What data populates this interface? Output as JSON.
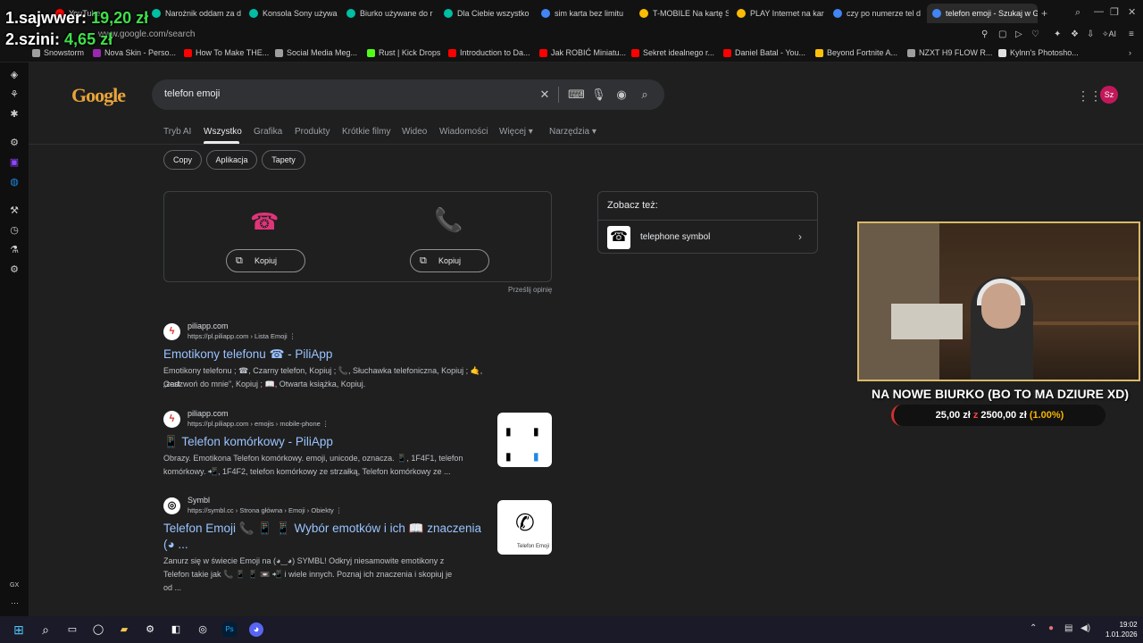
{
  "browser": {
    "tabs": [
      {
        "label": "YouTube",
        "color": "#ff0000"
      },
      {
        "label": "Narożnik oddam za d",
        "color": "#e91e63"
      },
      {
        "label": "Konsola Sony używa",
        "color": "#00bfa5"
      },
      {
        "label": "Biurko używane do r",
        "color": "#00bfa5"
      },
      {
        "label": "Dla Ciebie wszystko",
        "color": "#00bfa5"
      },
      {
        "label": "sim karta bez limitu",
        "color": "#4285f4"
      },
      {
        "label": "T-MOBILE Na kartę S",
        "color": "#fbbc04"
      },
      {
        "label": "PLAY Internet na kar",
        "color": "#fbbc04"
      },
      {
        "label": "czy po numerze tel d",
        "color": "#4285f4"
      },
      {
        "label": "telefon emoji - Szukaj w G",
        "color": "#4285f4"
      }
    ],
    "url": "www.google.com/search",
    "bookmarks": [
      {
        "label": "Snowstorm",
        "color": "#9e9e9e"
      },
      {
        "label": "Nova Skin - Perso...",
        "color": "#9c27b0"
      },
      {
        "label": "How To Make THE...",
        "color": "#ff0000"
      },
      {
        "label": "Social Media Meg...",
        "color": "#9e9e9e"
      },
      {
        "label": "Rust | Kick Drops",
        "color": "#53fc18"
      },
      {
        "label": "Introduction to Da...",
        "color": "#ff0000"
      },
      {
        "label": "Jak ROBIĆ Miniatu...",
        "color": "#ff0000"
      },
      {
        "label": "Sekret idealnego r...",
        "color": "#ff0000"
      },
      {
        "label": "Daniel Batal - You...",
        "color": "#ff0000"
      },
      {
        "label": "Beyond Fortnite A...",
        "color": "#ffc107"
      },
      {
        "label": "NZXT H9 FLOW R...",
        "color": "#9e9e9e"
      },
      {
        "label": "Kylnn's Photosho...",
        "color": "#e0e0e0"
      }
    ]
  },
  "google": {
    "logo": "Google",
    "query": "telefon emoji",
    "avatar": "Sz",
    "nav_tabs": [
      "Tryb AI",
      "Wszystko",
      "Grafika",
      "Produkty",
      "Krótkie filmy",
      "Wideo",
      "Wiadomości",
      "Więcej",
      "Narzędzia"
    ],
    "chips": [
      "Copy",
      "Aplikacja",
      "Tapety"
    ],
    "emoji_card": {
      "emojis": [
        "☎",
        "📞"
      ],
      "copy_label": "Kopiuj",
      "feedback": "Prześlij opinię"
    },
    "see_also": {
      "title": "Zobacz też:",
      "item": "telephone symbol"
    },
    "results": [
      {
        "site": "piliapp.com",
        "cite": "https://pl.piliapp.com › Lista Emoji",
        "title": "Emotikony telefonu ☎ - PiliApp",
        "snippet1": "Emotikony telefonu ; ☎, Czarny telefon, Kopiuj ; 📞, Słuchawka telefoniczna, Kopiuj ; 🤙, Gest",
        "snippet2": "„zadzwoń do mnie”, Kopiuj ; 📖, Otwarta książka, Kopiuj."
      },
      {
        "site": "piliapp.com",
        "cite": "https://pl.piliapp.com › emojis › mobile-phone",
        "title": "📱 Telefon komórkowy - PiliApp",
        "snippet1": "Obrazy. Emotikona Telefon komórkowy. emoji, unicode, oznacza. 📱, 1F4F1, telefon",
        "snippet2": "komórkowy. 📲, 1F4F2, telefon komórkowy ze strzałką, Telefon komórkowy ze ..."
      },
      {
        "site": "Symbl",
        "cite": "https://symbl.cc › Strona główna › Emoji › Obiekty",
        "title": "Telefon Emoji 📞 📱 📱 Wybór emotków i ich 📖 znaczenia",
        "title2": "(◕ ...",
        "snippet1": "Zanurz się w świecie Emoji na (◕‿◕) SYMBL! Odkryj niesamowite emotikony z",
        "snippet2": "Telefon takie jak 📞 📱 📱 📼 📲 i wiele innych. Poznaj ich znaczenia i skopiuj je",
        "snippet3": "od ..."
      }
    ],
    "thumb2_caption": "Telefon Emoji"
  },
  "overlay": {
    "donors": [
      {
        "rank": "1.",
        "name": "sajwwer:",
        "amount": "19,20 zł"
      },
      {
        "rank": "2.",
        "name": "szini:",
        "amount": "4,65 zł"
      }
    ],
    "goal_title": "NA NOWE BIURKO (BO TO MA DZIURE XD)",
    "goal_current": "25,00 zł",
    "goal_sep": "z",
    "goal_target": "2500,00 zł",
    "goal_pct": "(1.00%)",
    "goal_fraction": 0.01
  },
  "taskbar": {
    "time": "19:02",
    "date": "1.01.2026",
    "sidebar_label": "GX"
  }
}
